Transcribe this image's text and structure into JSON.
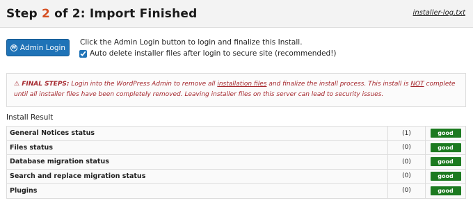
{
  "header": {
    "step_prefix": "Step ",
    "step_number": "2",
    "step_suffix": " of 2: Import Finished",
    "log_link": "installer-log.txt"
  },
  "login": {
    "button_label": "Admin Login",
    "instruction": "Click the Admin Login button to login and finalize this Install.",
    "auto_delete_label": "Auto delete installer files after login to secure site (recommended!)",
    "auto_delete_checked": true
  },
  "warning": {
    "lead": "FINAL STEPS:",
    "part1": " Login into the WordPress Admin to remove all ",
    "link": "installation files",
    "part2": " and finalize the install process. This install is ",
    "not": "NOT",
    "part3": " complete until all installer files have been completely removed. Leaving installer files on this server can lead to security issues."
  },
  "results": {
    "title": "Install Result",
    "rows": [
      {
        "name": "General Notices status",
        "count": "(1)",
        "status": "good"
      },
      {
        "name": "Files status",
        "count": "(0)",
        "status": "good"
      },
      {
        "name": "Database migration status",
        "count": "(0)",
        "status": "good"
      },
      {
        "name": "Search and replace migration status",
        "count": "(0)",
        "status": "good"
      },
      {
        "name": "Plugins",
        "count": "(0)",
        "status": "good"
      }
    ]
  },
  "colors": {
    "accent_blue": "#1f73b7",
    "step_number": "#d54e21",
    "warning_text": "#a4262c",
    "good_badge": "#1c7a20"
  }
}
